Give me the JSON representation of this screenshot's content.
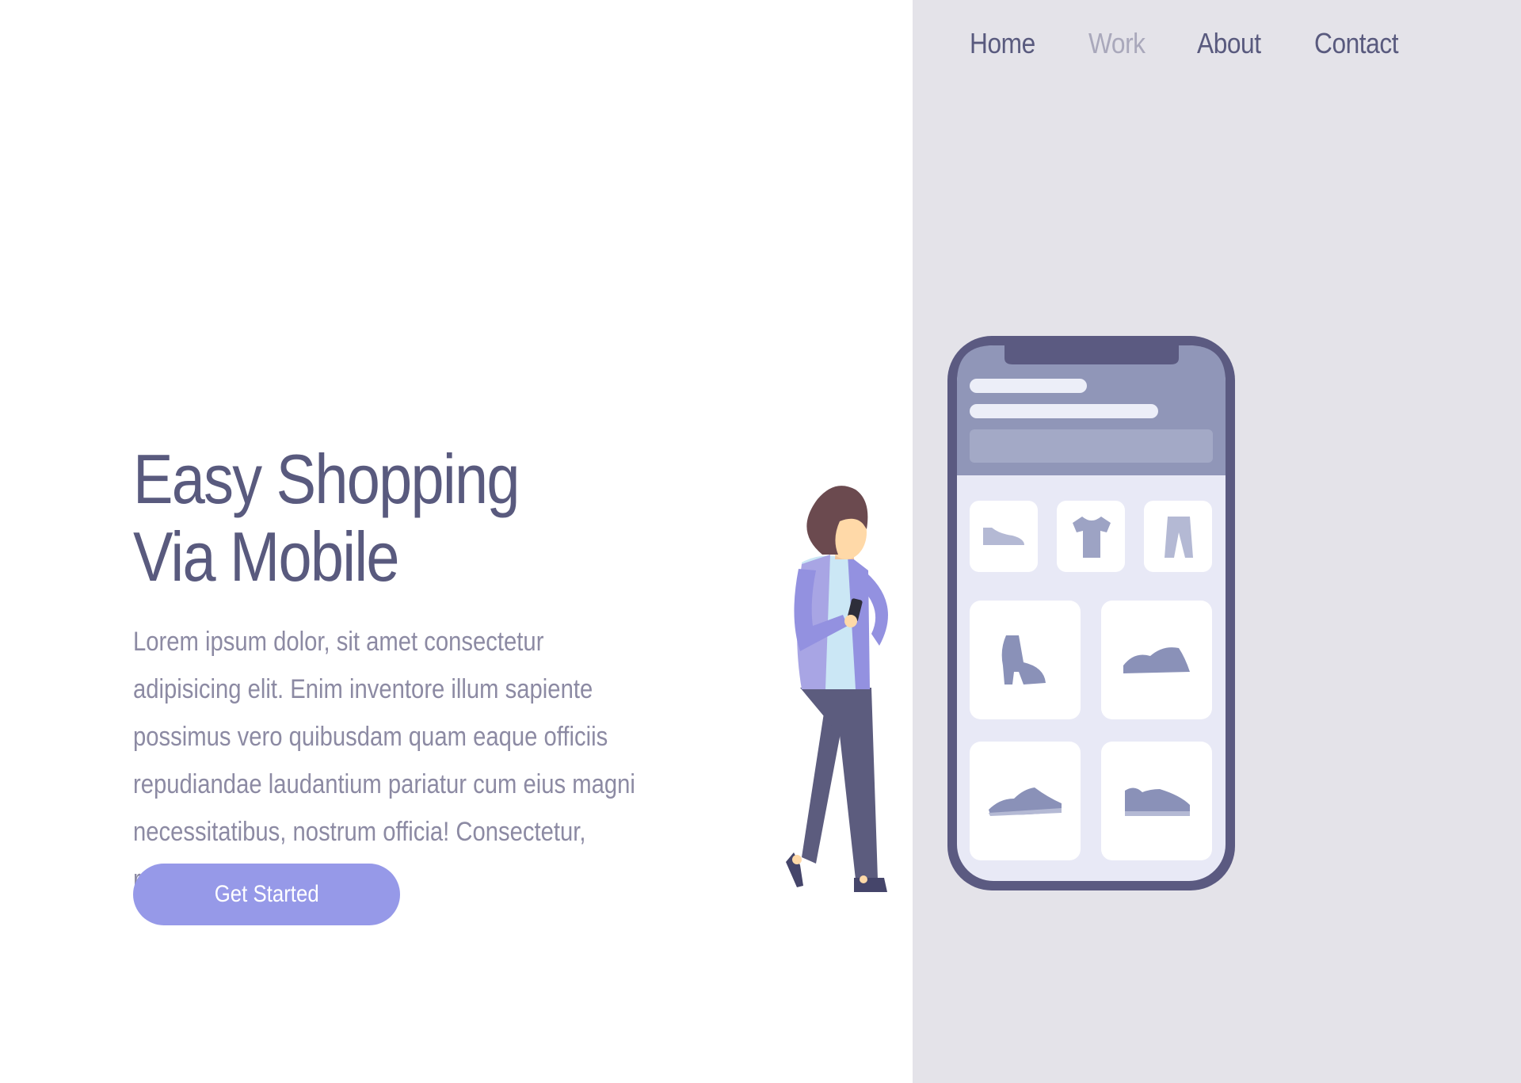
{
  "nav": {
    "items": [
      {
        "label": "Home"
      },
      {
        "label": "Work"
      },
      {
        "label": "About"
      },
      {
        "label": "Contact"
      }
    ]
  },
  "hero": {
    "title_line1": "Easy Shopping",
    "title_line2": "Via Mobile",
    "description": "Lorem ipsum dolor, sit amet consectetur adipisicing elit. Enim inventore illum sapiente possimus vero quibusdam quam eaque officiis repudiandae laudantium pariatur cum eius magni necessitatibus, nostrum officia! Consectetur, reprehenderit pariatur.",
    "cta_label": "Get Started"
  },
  "colors": {
    "primary_text": "#595a7e",
    "muted_text": "#8c8aa3",
    "accent": "#9699e8",
    "panel_bg": "#e4e3e9"
  },
  "illustration": {
    "icons": [
      "shoe-icon",
      "tshirt-icon",
      "pants-icon",
      "boot-icon",
      "sneaker-icon",
      "sneaker-icon",
      "sneaker-icon"
    ]
  }
}
